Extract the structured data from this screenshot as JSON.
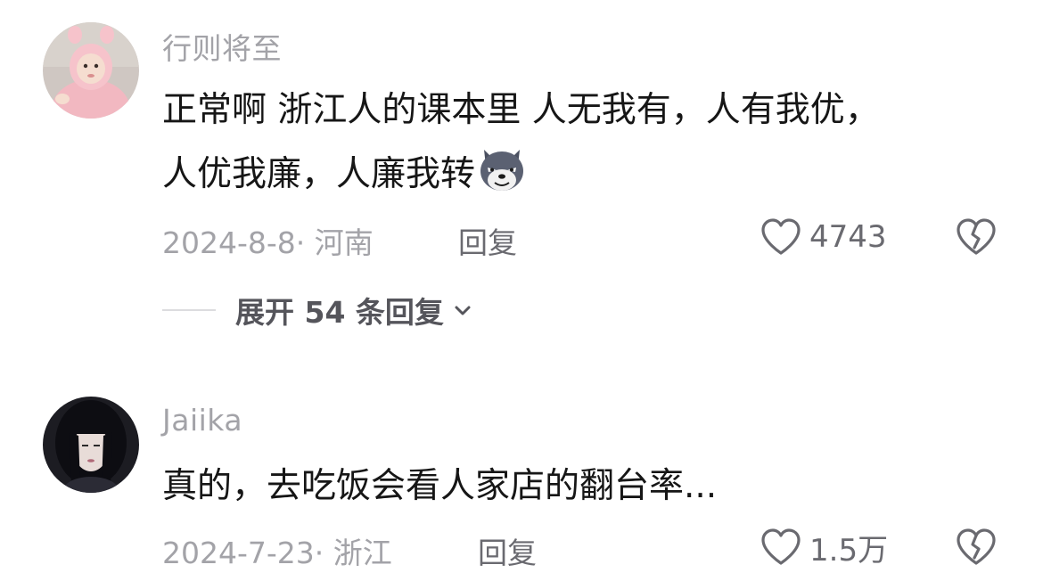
{
  "comments": [
    {
      "username": "行则将至",
      "lines": [
        "正常啊  浙江人的课本里 人无我有，人有我优，",
        "人优我廉，人廉我转"
      ],
      "emoji": "wolf-face-emoji",
      "date": "2024-8-8",
      "separator": "·",
      "location": "河南",
      "reply_label": "回复",
      "likes": "4743",
      "expand_replies": "展开 54 条回复"
    },
    {
      "username": "Jaiika",
      "lines": [
        "真的，去吃饭会看人家店的翻台率..."
      ],
      "date": "2024-7-23",
      "separator": "·",
      "location": "浙江",
      "reply_label": "回复",
      "likes": "1.5万"
    }
  ],
  "icons": {
    "like": "heart-outline-icon",
    "dislike": "broken-heart-icon",
    "expand": "chevron-down-icon"
  },
  "colors": {
    "text": "#161616",
    "secondary": "#a3a3a8",
    "action": "#6a6a70",
    "background": "#ffffff"
  }
}
